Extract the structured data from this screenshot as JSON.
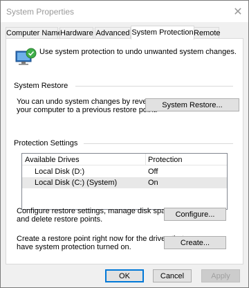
{
  "window": {
    "title": "System Properties",
    "close_glyph": "✕"
  },
  "tabs": [
    {
      "label": "Computer Name"
    },
    {
      "label": "Hardware"
    },
    {
      "label": "Advanced"
    },
    {
      "label": "System Protection",
      "active": true
    },
    {
      "label": "Remote"
    }
  ],
  "info": {
    "text": "Use system protection to undo unwanted system changes.",
    "icon": "system-protection-icon"
  },
  "system_restore": {
    "heading": "System Restore",
    "desc_line1": "You can undo system changes by reverting",
    "desc_line2": "your computer to a previous restore point.",
    "button": "System Restore..."
  },
  "protection": {
    "heading": "Protection Settings",
    "col_drives": "Available Drives",
    "col_protection": "Protection",
    "drives": [
      {
        "name": "Local Disk (D:)",
        "protection": "Off",
        "selected": false
      },
      {
        "name": "Local Disk (C:) (System)",
        "protection": "On",
        "selected": true
      }
    ],
    "configure_line1": "Configure restore settings, manage disk space,",
    "configure_line2": "and delete restore points.",
    "configure_button": "Configure...",
    "create_line1": "Create a restore point right now for the drives that",
    "create_line2": "have system protection turned on.",
    "create_button": "Create..."
  },
  "footer": {
    "ok": "OK",
    "cancel": "Cancel",
    "apply": "Apply"
  },
  "colors": {
    "accent": "#0078d7",
    "selection": "#e8e8e8"
  }
}
